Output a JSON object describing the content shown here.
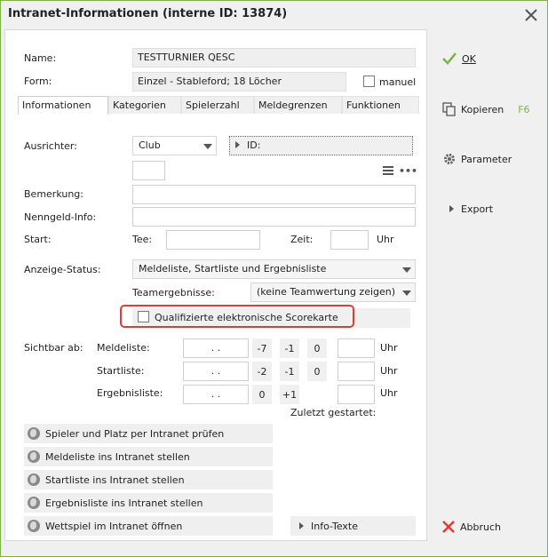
{
  "window": {
    "title": "Intranet-Informationen (interne ID: 13874)"
  },
  "form": {
    "name_label": "Name:",
    "name_value": "TESTTURNIER QESC",
    "form_label": "Form:",
    "form_value": "Einzel - Stableford; 18 Löcher",
    "manuel_label": "manuel"
  },
  "tabs": [
    "Informationen",
    "Kategorien",
    "Spielerzahl",
    "Meldegrenzen",
    "Funktionen"
  ],
  "info": {
    "ausrichter_label": "Ausrichter:",
    "ausrichter_value": "Club",
    "id_label": "ID:",
    "more_dots": "•••",
    "bemerkung_label": "Bemerkung:",
    "nenngeld_label": "Nenngeld-Info:",
    "start_label": "Start:",
    "tee_label": "Tee:",
    "zeit_label": "Zeit:",
    "uhr_label": "Uhr",
    "anzeige_label": "Anzeige-Status:",
    "anzeige_value": "Meldeliste, Startliste und Ergebnisliste",
    "team_label": "Teamergebnisse:",
    "team_value": "(keine Teamwertung zeigen)",
    "scorekarte_label": "Qualifizierte elektronische Scorekarte"
  },
  "visibility": {
    "sichtbar_label": "Sichtbar ab:",
    "rows": [
      {
        "label": "Meldeliste:",
        "date": ". .",
        "buttons": [
          "-7",
          "-1",
          "0"
        ],
        "uhr": "Uhr"
      },
      {
        "label": "Startliste:",
        "date": ". .",
        "buttons": [
          "-2",
          "-1",
          "0"
        ],
        "uhr": "Uhr"
      },
      {
        "label": "Ergebnisliste:",
        "date": ". .",
        "buttons": [
          "0",
          "+1"
        ],
        "uhr": "Uhr"
      }
    ],
    "zuletzt_label": "Zuletzt gestartet:"
  },
  "actions": [
    "Spieler und Platz per Intranet prüfen",
    "Meldeliste ins Intranet stellen",
    "Startliste ins Intranet stellen",
    "Ergebnisliste ins Intranet stellen",
    "Wettspiel im Intranet öffnen"
  ],
  "info_texte_label": "Info-Texte",
  "sidebar": {
    "ok_label": "OK",
    "kopieren_label": "Kopieren",
    "kopieren_shortcut": "F6",
    "parameter_label": "Parameter",
    "export_label": "Export",
    "abbruch_label": "Abbruch"
  },
  "colors": {
    "accent_green": "#7cb342",
    "highlight_red": "#e53935"
  }
}
